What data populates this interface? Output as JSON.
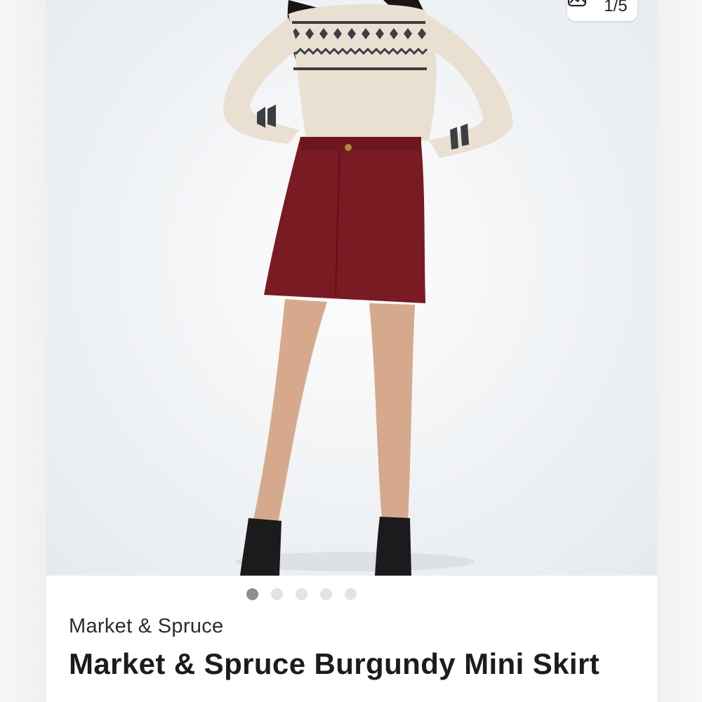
{
  "gallery": {
    "counter_text": "1/5",
    "counter_icon": "gallery-icon",
    "current_index": 1,
    "total_images": 5
  },
  "product": {
    "brand": "Market & Spruce",
    "title": "Market & Spruce Burgundy Mini Skirt"
  },
  "colors": {
    "skirt": "#7a1a22",
    "sweater": "#e9e0d2",
    "active_dot": "#8e8e90",
    "inactive_dot": "#e2e3e5"
  }
}
